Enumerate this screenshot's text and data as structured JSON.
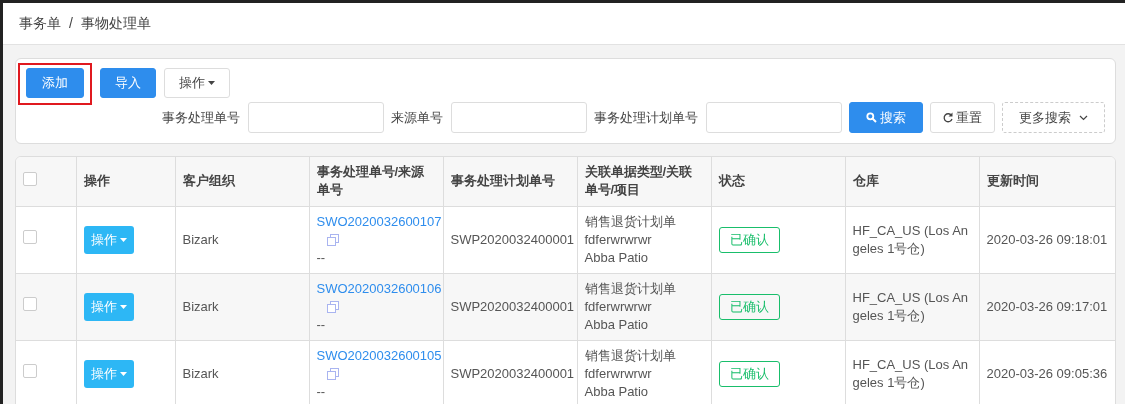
{
  "breadcrumb": [
    "事务单",
    "事物处理单"
  ],
  "breadcrumb_separator": "/",
  "toolbar": [
    {
      "label": "添加",
      "kind": "primary",
      "highlighted": true
    },
    {
      "label": "导入",
      "kind": "primary",
      "highlighted": false
    },
    {
      "label": "操作",
      "kind": "dropdown",
      "highlighted": false
    }
  ],
  "filters": [
    {
      "label": "事务处理单号"
    },
    {
      "label": "来源单号"
    },
    {
      "label": "事务处理计划单号"
    }
  ],
  "search_buttons": [
    {
      "label": "搜索",
      "kind": "search"
    },
    {
      "label": "重置",
      "kind": "reset"
    },
    {
      "label": "更多搜索",
      "kind": "more"
    }
  ],
  "table": {
    "select_all_checked": false,
    "columns": [
      "操作",
      "客户组织",
      "事务处理单号/来源单号",
      "事务处理计划单号",
      "关联单据类型/关联单号/项目",
      "状态",
      "仓库",
      "更新时间"
    ],
    "rows": [
      {
        "checked": false,
        "action": "操作",
        "org": "Bizark",
        "order_no": "SWO2020032600107",
        "source_no": "--",
        "plan_no": "SWP2020032400001",
        "related": [
          "销售退货计划单",
          "fdferwrwrwr",
          "Abba Patio"
        ],
        "status": "已确认",
        "warehouse": "HF_CA_US (Los Angeles 1号仓)",
        "updated": "2020-03-26 09:18:01"
      },
      {
        "checked": false,
        "action": "操作",
        "org": "Bizark",
        "order_no": "SWO2020032600106",
        "source_no": "--",
        "plan_no": "SWP2020032400001",
        "related": [
          "销售退货计划单",
          "fdferwrwrwr",
          "Abba Patio"
        ],
        "status": "已确认",
        "warehouse": "HF_CA_US (Los Angeles 1号仓)",
        "updated": "2020-03-26 09:17:01"
      },
      {
        "checked": false,
        "action": "操作",
        "org": "Bizark",
        "order_no": "SWO2020032600105",
        "source_no": "--",
        "plan_no": "SWP2020032400001",
        "related": [
          "销售退货计划单",
          "fdferwrwrwr",
          "Abba Patio"
        ],
        "status": "已确认",
        "warehouse": "HF_CA_US (Los Angeles 1号仓)",
        "updated": "2020-03-26 09:05:36"
      }
    ]
  }
}
